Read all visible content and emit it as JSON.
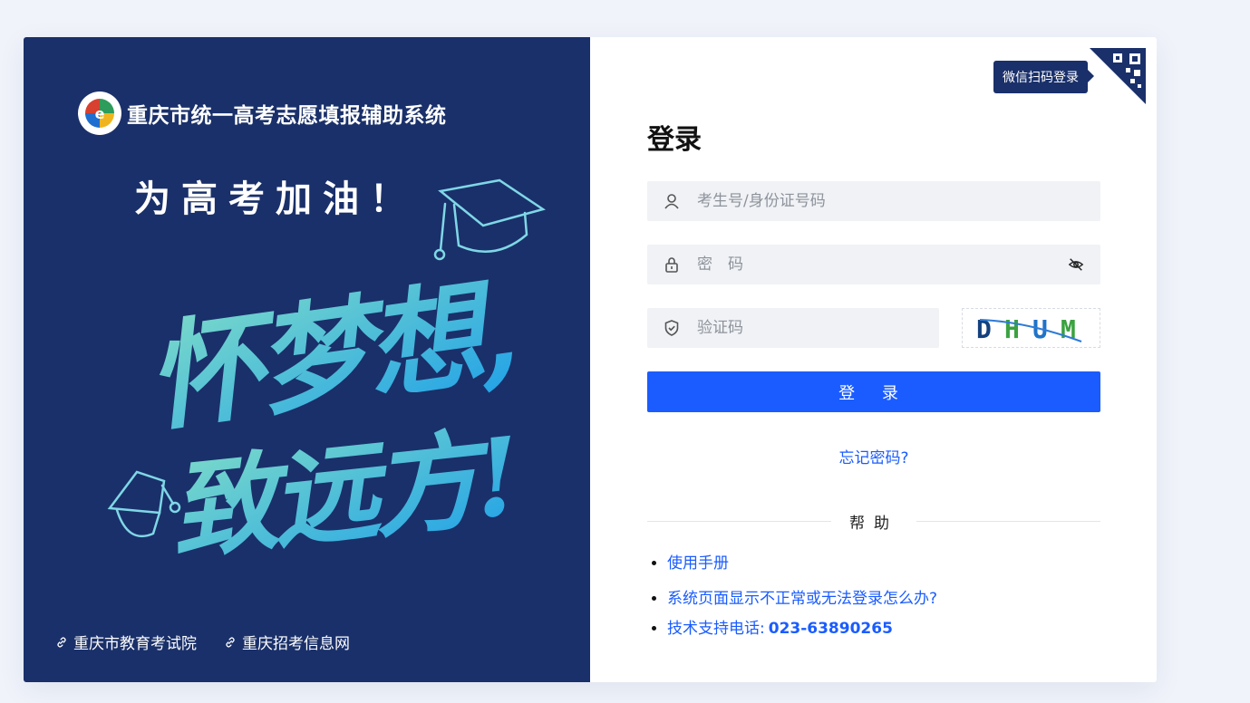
{
  "brand": {
    "title": "重庆市统一高考志愿填报辅助系统",
    "logo_icon": "exam-authority-logo"
  },
  "slogan": "为高考加油！",
  "art": {
    "calligraphy": "怀梦想，致远方！",
    "icon": "graduation-cap-icon"
  },
  "left_links": [
    {
      "label": "重庆市教育考试院",
      "icon": "link-icon"
    },
    {
      "label": "重庆招考信息网",
      "icon": "link-icon"
    }
  ],
  "qr_login": {
    "tooltip": "微信扫码登录",
    "icon": "qr-code-icon"
  },
  "login": {
    "title": "登录",
    "username_placeholder": "考生号/身份证号码",
    "password_placeholder": "密　码",
    "captcha_placeholder": "验证码",
    "captcha_text": "DHUM",
    "submit_label": "登 录",
    "forgot_label": "忘记密码?"
  },
  "help": {
    "label": "帮助",
    "items": [
      {
        "label": "使用手册"
      },
      {
        "label": "系统页面显示不正常或无法登录怎么办?"
      },
      {
        "label": "技术支持电话:",
        "phone": "023-63890265"
      }
    ]
  },
  "colors": {
    "page_bg": "#f0f3fa",
    "panel_navy": "#1a306a",
    "primary_blue": "#1a5cff",
    "input_bg": "#f0f2f5"
  }
}
